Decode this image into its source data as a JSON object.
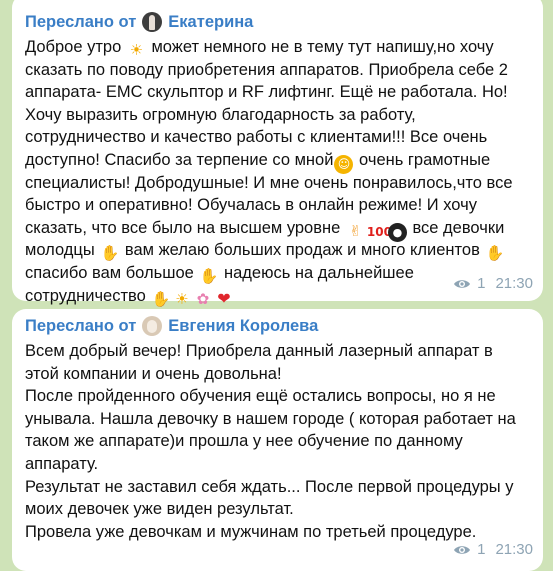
{
  "messages": [
    {
      "forwarded_prefix": "Переслано от",
      "author": "Екатерина",
      "lines": [
        [
          "Доброе утро ",
          {
            "icon": "sun-emoji",
            "glyph": "☀"
          },
          " может немного не в тему тут напишу,но хочу"
        ],
        [
          "сказать по поводу приобретения аппаратов. Приобрела себе 2"
        ],
        [
          "аппарата- ЕМС скульптор и RF лифтинг. Ещё не работала. Но!"
        ],
        [
          "Хочу выразить огромную благодарность за работу,"
        ],
        [
          "сотрудничество и качество работы с клиентами!!! Все очень"
        ],
        [
          "доступно! Спасибо за терпение со мной",
          {
            "icon": "grin-emoji",
            "glyph": "☺"
          },
          " очень грамотные"
        ],
        [
          "специалисты! Добродушные! И мне очень понравилось,что все"
        ],
        [
          "быстро и оперативно! Обучалась в онлайн режиме! И хочу"
        ],
        [
          "сказать, что все было на высшем уровне ",
          {
            "icon": "ok-hand-emoji",
            "glyph": "✌"
          },
          {
            "icon": "hundred-emoji",
            "glyph": "100"
          },
          {
            "icon": "bomb-emoji",
            "glyph": "●"
          },
          " все девочки"
        ],
        [
          "молодцы ",
          {
            "icon": "clapping-hands-emoji",
            "glyph": "✋"
          },
          " вам желаю больших продаж и много клиентов ",
          {
            "icon": "raised-hands-emoji",
            "glyph": "✋"
          }
        ],
        [
          "спасибо вам большое ",
          {
            "icon": "handshake-emoji",
            "glyph": "✋"
          },
          " надеюсь на дальнейшее"
        ],
        [
          "сотрудничество ",
          {
            "icon": "handshake-emoji",
            "glyph": "✋"
          },
          {
            "icon": "sun-emoji",
            "glyph": "☀"
          },
          {
            "icon": "flower-emoji",
            "glyph": "✿"
          },
          {
            "icon": "heart-emoji",
            "glyph": "❤"
          }
        ]
      ],
      "views": "1",
      "time": "21:30"
    },
    {
      "forwarded_prefix": "Переслано от",
      "author": "Евгения Королева",
      "lines": [
        [
          "Всем добрый вечер! Приобрела данный лазерный аппарат в"
        ],
        [
          "этой компании и очень довольна!"
        ],
        [
          "После пройденного обучения ещё остались вопросы, но я не"
        ],
        [
          "унывала.  Нашла девочку в нашем городе ( которая работает на"
        ],
        [
          "таком же аппарате)и прошла у нее обучение по данному"
        ],
        [
          "аппарату."
        ],
        [
          "Результат не заставил себя ждать... После первой процедуры у"
        ],
        [
          "моих девочек уже виден результат."
        ],
        [
          "Провела уже девочкам и мужчинам по третьей процедуре."
        ]
      ],
      "views": "1",
      "time": "21:30"
    }
  ],
  "colors": {
    "background": "#cfe3b8",
    "bubble": "#ffffff",
    "forward_link": "#3a7ec6",
    "meta": "#8ea4b4"
  }
}
